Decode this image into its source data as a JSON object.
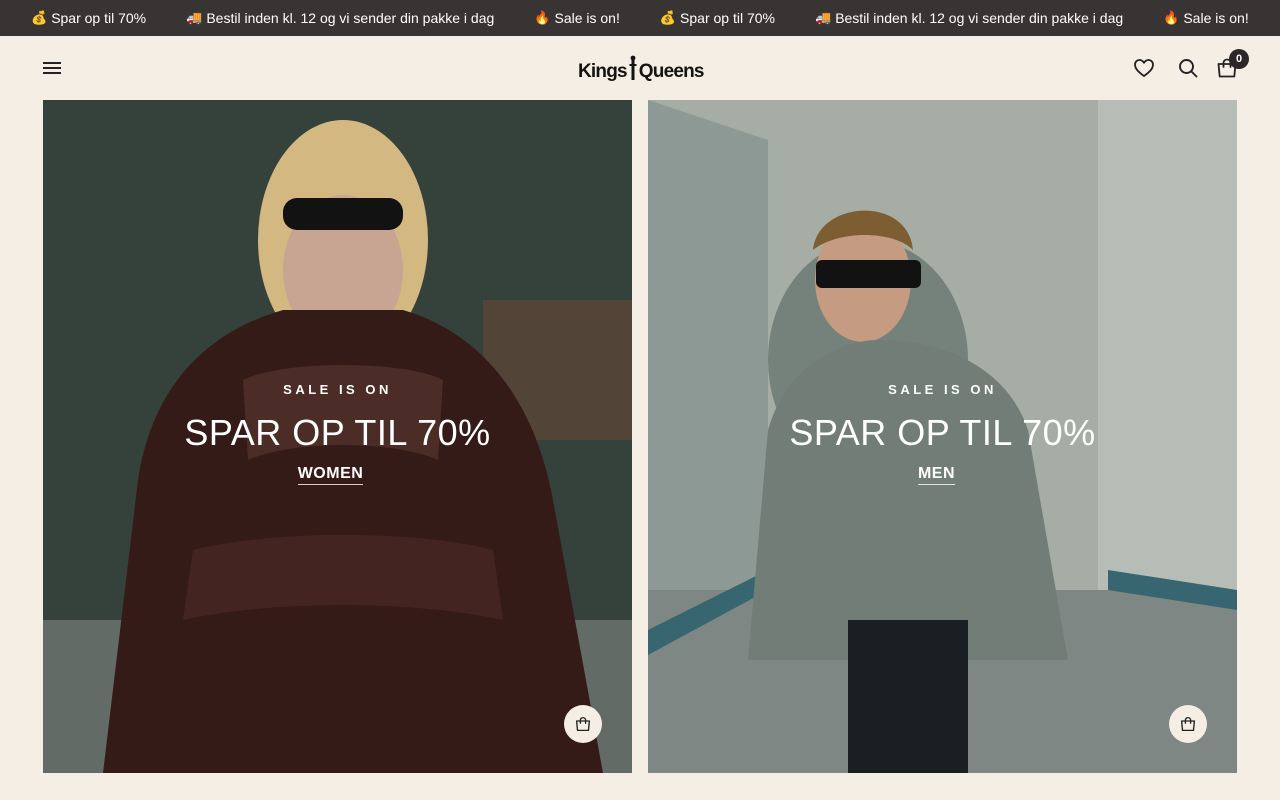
{
  "announcement": {
    "items": [
      {
        "emoji": "💰",
        "text": "Spar op til 70%"
      },
      {
        "emoji": "🚚",
        "text": "Bestil inden kl. 12 og vi sender din pakke i dag"
      },
      {
        "emoji": "🔥",
        "text": "Sale is on!"
      },
      {
        "emoji": "💰",
        "text": "Spar op til 70%"
      },
      {
        "emoji": "🚚",
        "text": "Bestil inden kl. 12 og vi sender din pakke i dag"
      },
      {
        "emoji": "🔥",
        "text": "Sale is on!"
      }
    ]
  },
  "header": {
    "logo_part1": "Kings",
    "logo_part2": "Queens",
    "cart_count": "0"
  },
  "cards": [
    {
      "eyebrow": "SALE IS ON",
      "headline": "SPAR OP TIL 70%",
      "cta": "WOMEN"
    },
    {
      "eyebrow": "SALE IS ON",
      "headline": "SPAR OP TIL 70%",
      "cta": "MEN"
    }
  ],
  "colors": {
    "announcement_bg": "#383433",
    "page_bg": "#f5eee4",
    "text_dark": "#222222"
  },
  "icons": {
    "menu": "menu-icon",
    "wishlist": "heart-icon",
    "search": "search-icon",
    "cart": "shopping-bag-icon",
    "quick_add": "shopping-bag-icon"
  }
}
